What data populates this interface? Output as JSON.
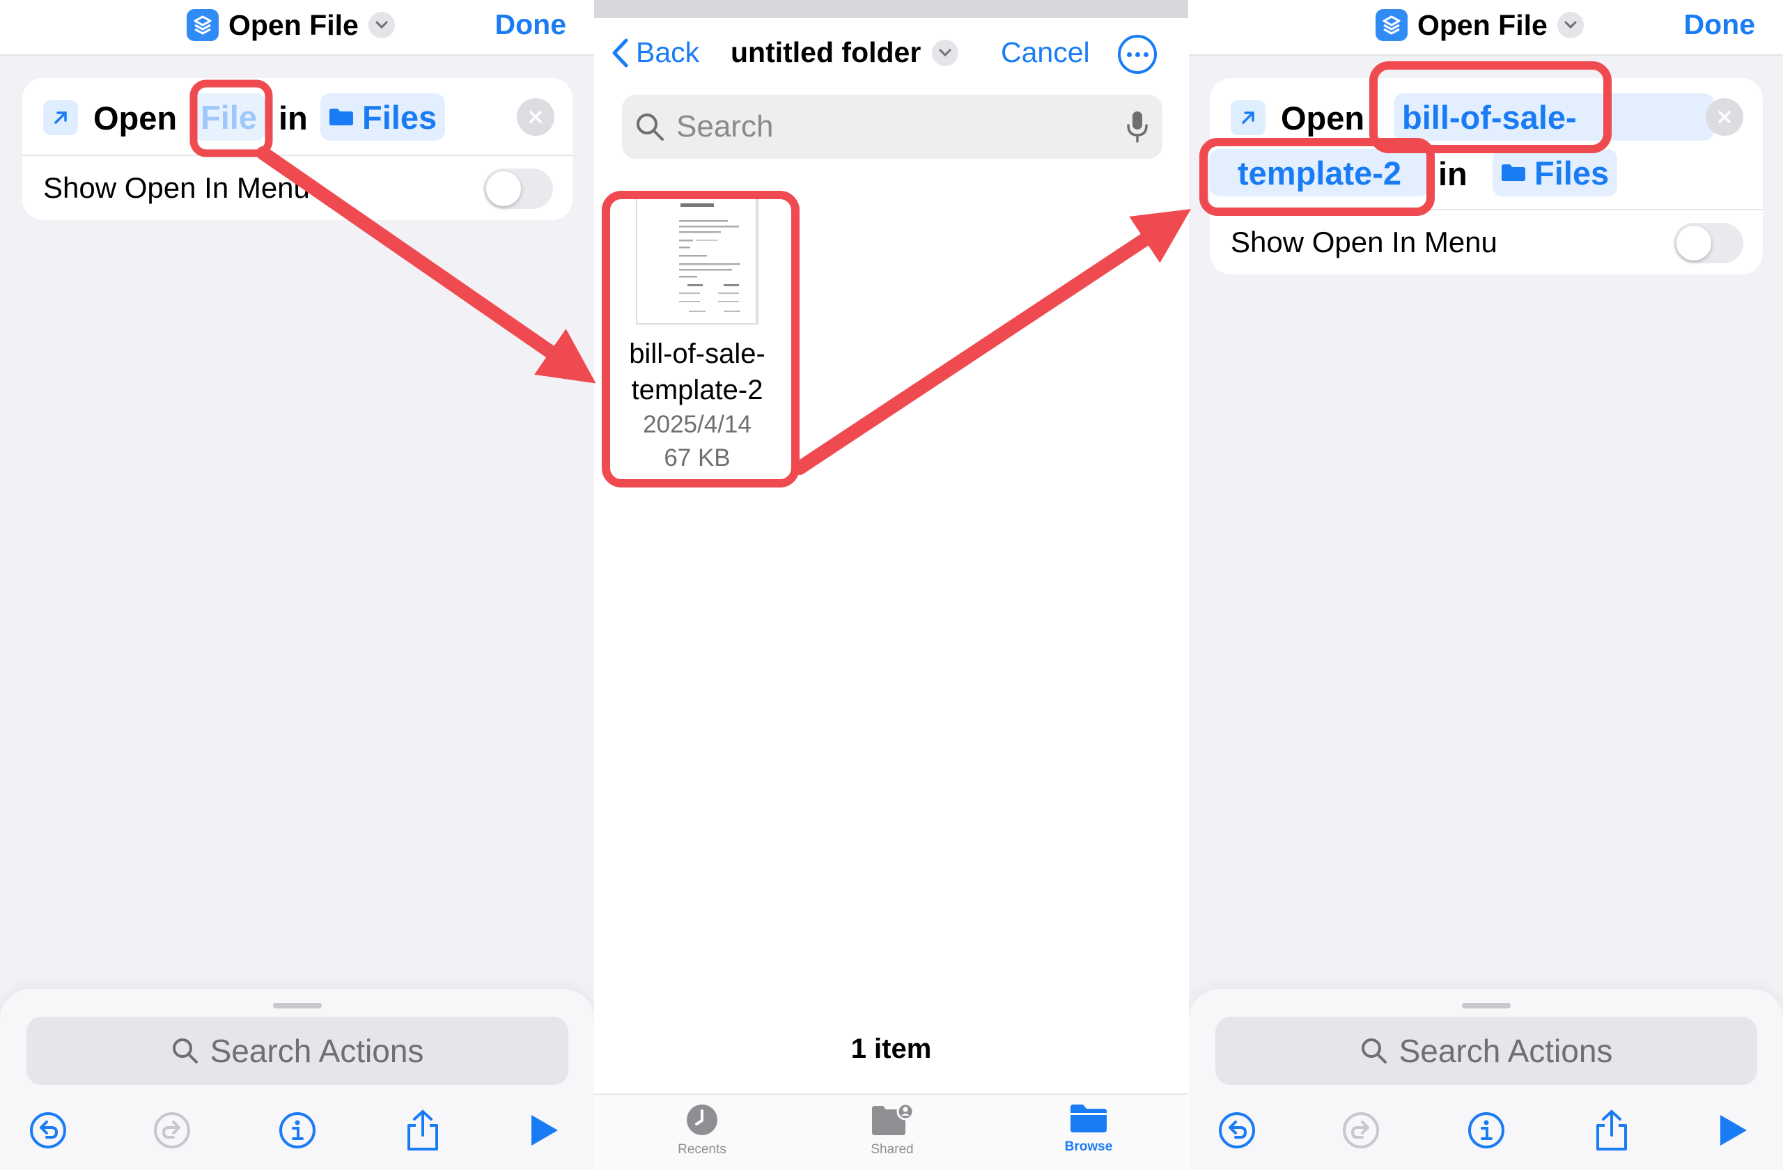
{
  "left": {
    "title": "Open File",
    "done": "Done",
    "action": {
      "open": "Open",
      "file_token": "File",
      "in": "in",
      "location_token": "Files",
      "show_open_in_menu": "Show Open In Menu"
    },
    "search_actions": "Search Actions"
  },
  "middle": {
    "back": "Back",
    "folder_title": "untitled folder",
    "cancel": "Cancel",
    "search_placeholder": "Search",
    "file": {
      "name_line1": "bill-of-sale-",
      "name_line2": "template-2",
      "date": "2025/4/14",
      "size": "67 KB"
    },
    "item_count": "1 item",
    "tabs": [
      {
        "label": "Recents"
      },
      {
        "label": "Shared"
      },
      {
        "label": "Browse"
      }
    ]
  },
  "right": {
    "title": "Open File",
    "done": "Done",
    "action": {
      "open": "Open",
      "file_token_line1": "bill-of-sale-",
      "file_token_line2": "template-2",
      "in": "in",
      "location_token": "Files",
      "show_open_in_menu": "Show Open In Menu"
    },
    "search_actions": "Search Actions"
  },
  "colors": {
    "accent": "#1a7cf4",
    "highlight": "#ef4a4f",
    "background": "#f2f1f6"
  }
}
